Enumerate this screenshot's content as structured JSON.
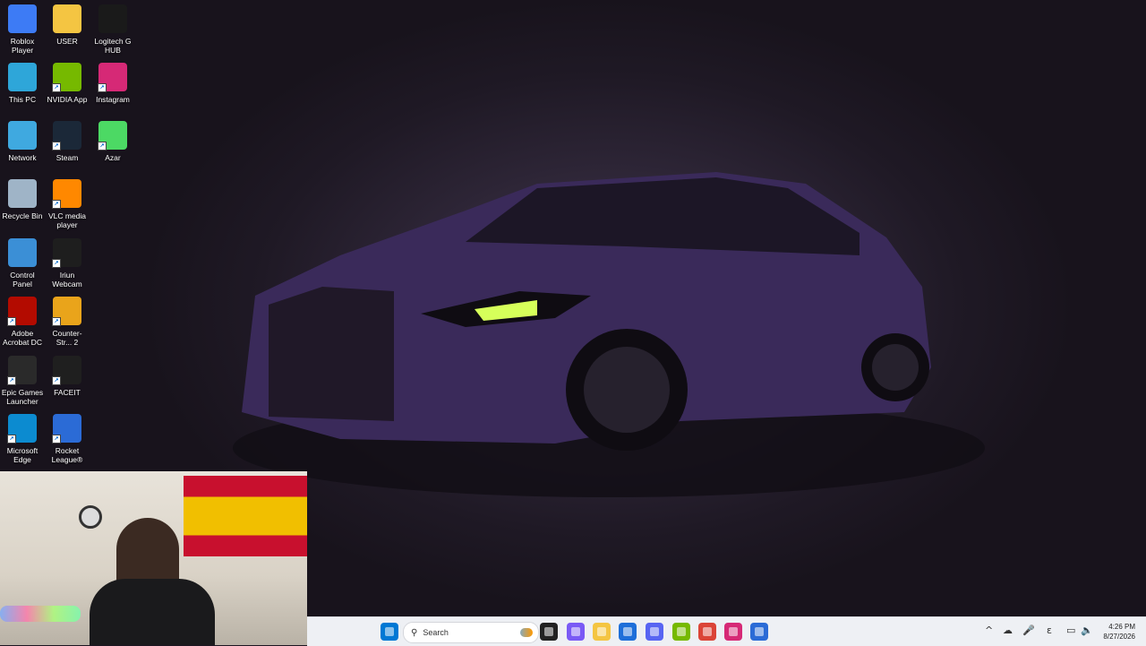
{
  "desktop": {
    "icons": [
      {
        "label": "Roblox Player",
        "icon": "roblox-icon",
        "color": "#3d7bf5"
      },
      {
        "label": "USER",
        "icon": "folder-icon",
        "color": "#f4c542"
      },
      {
        "label": "Logitech G HUB",
        "icon": "logitech-icon",
        "color": "#1a1a1a"
      },
      {
        "label": "This PC",
        "icon": "monitor-icon",
        "color": "#2ea6d9"
      },
      {
        "label": "NVIDIA App",
        "icon": "nvidia-icon",
        "color": "#76b900"
      },
      {
        "label": "Instagram",
        "icon": "instagram-icon",
        "color": "#d62976"
      },
      {
        "label": "Network",
        "icon": "network-icon",
        "color": "#3fa9e0"
      },
      {
        "label": "Steam",
        "icon": "steam-icon",
        "color": "#1b2838"
      },
      {
        "label": "Azar",
        "icon": "azar-icon",
        "color": "#4cd964"
      },
      {
        "label": "Recycle Bin",
        "icon": "recycle-bin-icon",
        "color": "#9fb4c7"
      },
      {
        "label": "VLC media player",
        "icon": "vlc-icon",
        "color": "#ff8800"
      },
      {
        "label": "Control Panel",
        "icon": "control-panel-icon",
        "color": "#3b8fd6"
      },
      {
        "label": "Iriun Webcam",
        "icon": "iriun-icon",
        "color": "#1e1e1e"
      },
      {
        "label": "Adobe Acrobat DC",
        "icon": "acrobat-icon",
        "color": "#b30b00"
      },
      {
        "label": "Counter-Str... 2",
        "icon": "cs2-icon",
        "color": "#e9a41b"
      },
      {
        "label": "Epic Games Launcher",
        "icon": "epic-games-icon",
        "color": "#2a2a2a"
      },
      {
        "label": "FACEIT",
        "icon": "faceit-icon",
        "color": "#1f1f1f"
      },
      {
        "label": "Microsoft Edge",
        "icon": "edge-icon",
        "color": "#0c8bd0"
      },
      {
        "label": "Rocket League®",
        "icon": "rocket-league-icon",
        "color": "#2b6bd6"
      }
    ]
  },
  "taskbar": {
    "search_placeholder": "Search",
    "apps": [
      {
        "name": "start-button",
        "icon": "windows-icon",
        "color": "#0078d4"
      },
      {
        "name": "task-view",
        "icon": "task-view-icon",
        "color": "#222222"
      },
      {
        "name": "widgets",
        "icon": "widgets-icon",
        "color": "#7a5af5"
      },
      {
        "name": "file-explorer",
        "icon": "folder-icon",
        "color": "#f4c542"
      },
      {
        "name": "microsoft-store",
        "icon": "store-icon",
        "color": "#1e6fd9"
      },
      {
        "name": "discord",
        "icon": "discord-icon",
        "color": "#5865f2"
      },
      {
        "name": "nvidia-app",
        "icon": "nvidia-icon",
        "color": "#76b900"
      },
      {
        "name": "chrome",
        "icon": "chrome-icon",
        "color": "#db4437"
      },
      {
        "name": "instagram",
        "icon": "instagram-icon",
        "color": "#d62976"
      },
      {
        "name": "rocket-league",
        "icon": "rocket-league-icon",
        "color": "#2b6bd6"
      }
    ],
    "tray": {
      "chevron": "^",
      "language": "ε"
    },
    "clock": {
      "time": "4:26 PM",
      "date": "8/27/2026"
    }
  }
}
